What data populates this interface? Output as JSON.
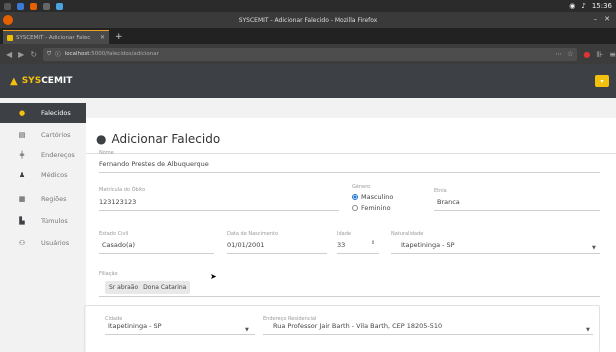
{
  "system": {
    "clock": "15:36"
  },
  "window": {
    "title": "SYSCEMIT - Adicionar Falecido - Mozilla Firefox"
  },
  "browser": {
    "tab_title": "SYSCEMIT - Adicionar Falec",
    "url_host": "localhost",
    "url_path": ":5000/falecidos/adicionar"
  },
  "app": {
    "brand_sys": "SYS",
    "brand_cemit": "CEMIT"
  },
  "sidebar": {
    "items": [
      {
        "label": "Falecidos",
        "icon": "grave-icon",
        "active": true
      },
      {
        "label": "Cartórios",
        "icon": "building-icon"
      },
      {
        "label": "Endereços",
        "icon": "signpost-icon"
      },
      {
        "label": "Médicos",
        "icon": "user-icon"
      },
      {
        "label": "Regiões",
        "icon": "map-icon"
      },
      {
        "label": "Túmulos",
        "icon": "tomb-icon"
      },
      {
        "label": "Usuários",
        "icon": "users-icon"
      }
    ]
  },
  "page": {
    "title": "Adicionar Falecido"
  },
  "form": {
    "nome": {
      "label": "Nome",
      "value": "Fernando Prestes de Albuquerque"
    },
    "matricula": {
      "label": "Matrícula do Óbito",
      "value": "123123123"
    },
    "genero": {
      "label": "Gênero",
      "options": [
        "Masculino",
        "Feminino"
      ],
      "selected": "Masculino"
    },
    "etnia": {
      "label": "Etnia",
      "value": "Branca"
    },
    "estado_civil": {
      "label": "Estado Civil",
      "value": "Casado(a)"
    },
    "data_nascimento": {
      "label": "Data de Nascimento",
      "value": "01/01/2001"
    },
    "idade": {
      "label": "Idade",
      "value": "33"
    },
    "naturalidade": {
      "label": "Naturalidade",
      "value": "Itapetininga - SP"
    },
    "filiacao": {
      "label": "Filiação",
      "values": [
        "Sr abraão",
        "Dona Catarina"
      ]
    },
    "cidade": {
      "label": "Cidade",
      "value": "Itapetininga - SP"
    },
    "endereco": {
      "label": "Endereço Residencial",
      "value": "Rua Professor Jair Barth - Vila Barth, CEP 18205-510"
    }
  },
  "colors": {
    "accent": "#f3c10c",
    "dark": "#3d4045",
    "radio": "#1e73d2"
  }
}
